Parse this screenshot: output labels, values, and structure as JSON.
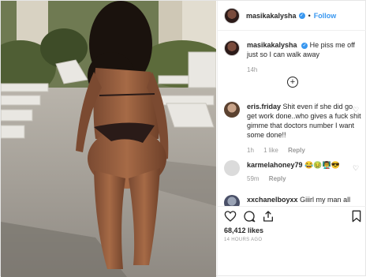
{
  "post": {
    "username": "masikakalysha",
    "follow_label": "Follow",
    "separator": "•",
    "verified_glyph": "✓"
  },
  "caption": {
    "username": "masikakalysha",
    "text": "He piss me off just so I can walk away",
    "age": "14h"
  },
  "comments": [
    {
      "username": "eris.friday",
      "text": "Shit even if she did go get work done..who gives a fuck shit gimme that doctors number I want some done!!",
      "age": "1h",
      "likes": "1 like",
      "reply": "Reply"
    },
    {
      "username": "karmelahoney79",
      "text": "😂🤢👨‍🏫😎",
      "age": "59m",
      "reply": "Reply"
    },
    {
      "username": "xxchanelboyxx",
      "text": "Giiirl my man all day"
    }
  ],
  "actions": {
    "like_icon": "heart-icon",
    "comment_icon": "comment-icon",
    "share_icon": "share-icon",
    "save_icon": "bookmark-icon",
    "likes_count": "68,412 likes",
    "timestamp": "14 HOURS AGO"
  },
  "colors": {
    "link": "#3897f0",
    "text": "#262626",
    "meta": "#999999",
    "border": "#efefef"
  }
}
